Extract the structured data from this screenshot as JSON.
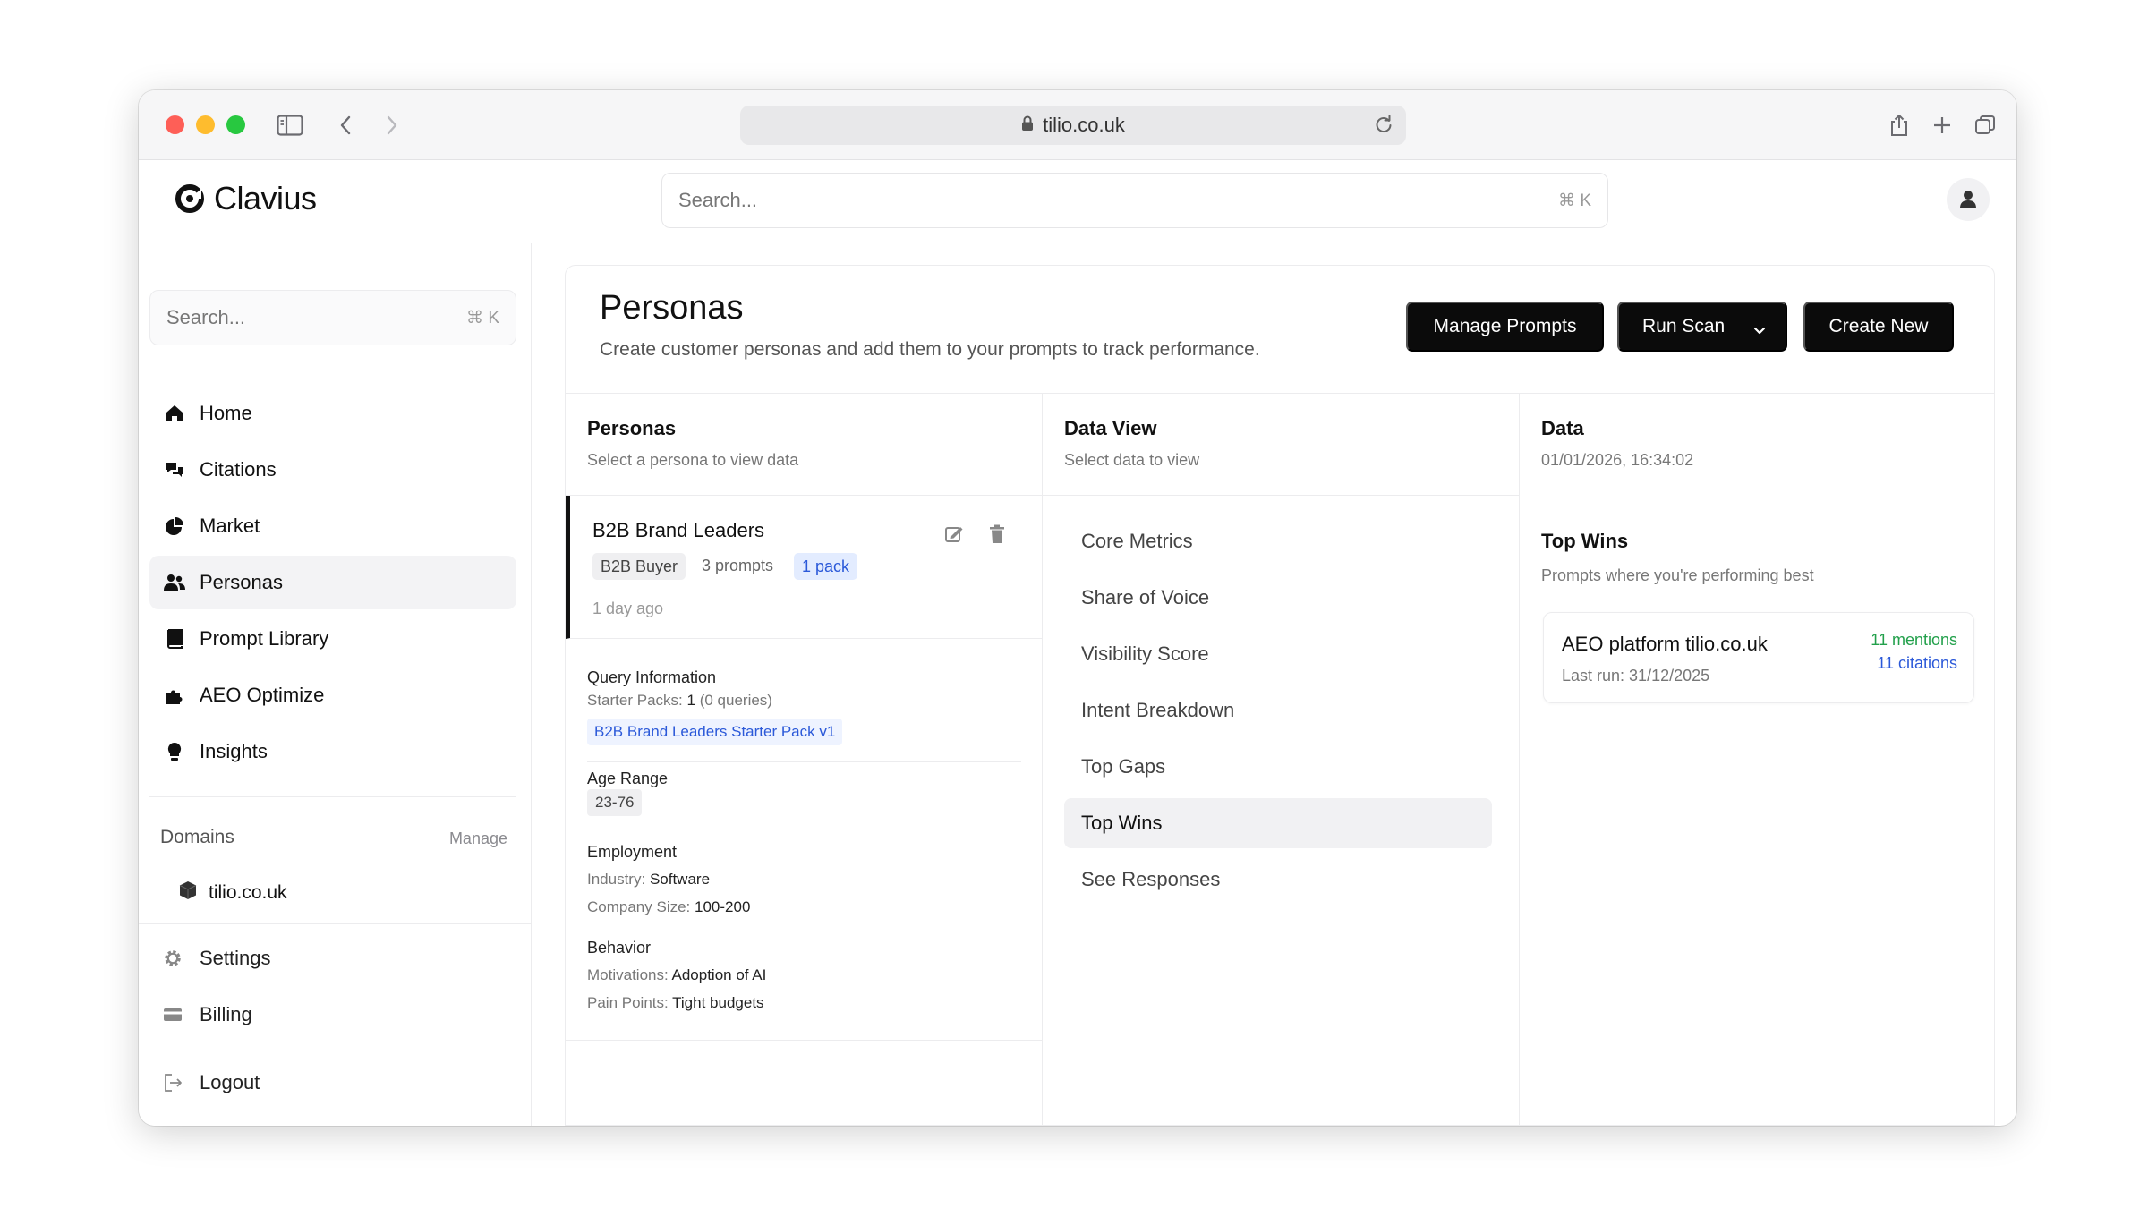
{
  "browser": {
    "url": "tilio.co.uk"
  },
  "app": {
    "logo_text": "Clavius",
    "search_placeholder": "Search...",
    "search_shortcut": "⌘ K"
  },
  "sidebar": {
    "search_placeholder": "Search...",
    "search_shortcut": "⌘ K",
    "nav": [
      {
        "label": "Home",
        "icon": "home-icon"
      },
      {
        "label": "Citations",
        "icon": "citations-icon"
      },
      {
        "label": "Market",
        "icon": "pie-chart-icon"
      },
      {
        "label": "Personas",
        "icon": "users-icon"
      },
      {
        "label": "Prompt Library",
        "icon": "book-icon"
      },
      {
        "label": "AEO Optimize",
        "icon": "puzzle-icon"
      },
      {
        "label": "Insights",
        "icon": "lightbulb-icon"
      }
    ],
    "active_index": 3,
    "domains_label": "Domains",
    "domains_manage": "Manage",
    "domains": [
      "tilio.co.uk"
    ],
    "settings_label": "Settings",
    "billing_label": "Billing",
    "logout_label": "Logout"
  },
  "page": {
    "title": "Personas",
    "subtitle": "Create customer personas and add them to your prompts to track performance.",
    "buttons": {
      "manage_prompts": "Manage Prompts",
      "run_scan": "Run Scan",
      "create_new": "Create New"
    }
  },
  "personas_col": {
    "title": "Personas",
    "subtitle": "Select a persona to view data",
    "persona": {
      "name": "B2B Brand Leaders",
      "tag": "B2B Buyer",
      "prompts": "3 prompts",
      "packs": "1 pack",
      "updated": "1 day ago"
    },
    "query_info": {
      "title": "Query Information",
      "starter_packs_label": "Starter Packs:",
      "starter_packs_count": "1",
      "starter_packs_queries": "(0 queries)",
      "pack_name": "B2B Brand Leaders Starter Pack v1"
    },
    "age": {
      "title": "Age Range",
      "value": "23-76"
    },
    "employment": {
      "title": "Employment",
      "industry_label": "Industry:",
      "industry": "Software",
      "company_size_label": "Company Size:",
      "company_size": "100-200"
    },
    "behavior": {
      "title": "Behavior",
      "motivations_label": "Motivations:",
      "motivations": "Adoption of AI",
      "pain_points_label": "Pain Points:",
      "pain_points": "Tight budgets"
    }
  },
  "dataview_col": {
    "title": "Data View",
    "subtitle": "Select data to view",
    "items": [
      "Core Metrics",
      "Share of Voice",
      "Visibility Score",
      "Intent Breakdown",
      "Top Gaps",
      "Top Wins",
      "See Responses"
    ],
    "active_index": 5
  },
  "data_col": {
    "title": "Data",
    "timestamp": "01/01/2026, 16:34:02",
    "section_title": "Top Wins",
    "section_subtitle": "Prompts where you're performing best",
    "wins": [
      {
        "prompt": "AEO platform tilio.co.uk",
        "last_run": "Last run: 31/12/2025",
        "mentions": "11 mentions",
        "citations": "11 citations"
      }
    ]
  },
  "colors": {
    "primary_button": "#0b0b0b",
    "link_blue": "#2b59d9",
    "mention_green": "#22a04b"
  }
}
